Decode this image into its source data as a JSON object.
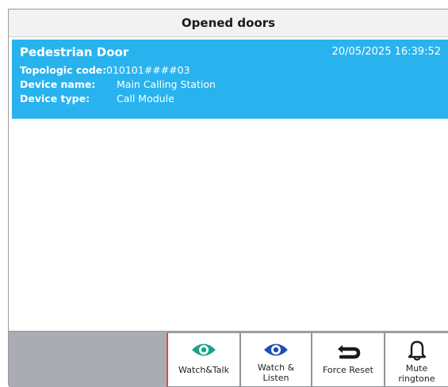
{
  "header": {
    "title": "Opened doors"
  },
  "door": {
    "name": "Pedestrian Door",
    "timestamp": "20/05/2025 16:39:52",
    "topologic_label": "Topologic code:",
    "topologic_value": "010101####03",
    "device_name_label": "Device name:",
    "device_name_value": "Main Calling Station",
    "device_type_label": "Device type:",
    "device_type_value": "Call Module"
  },
  "buttons": {
    "watch_talk": {
      "label": "Watch&Talk",
      "icon": "eye-icon",
      "color": "#17a589"
    },
    "watch_listen": {
      "label": "Watch &\nListen",
      "icon": "eye-icon",
      "color": "#1f4fb3"
    },
    "force_reset": {
      "label": "Force Reset",
      "icon": "refresh-icon",
      "color": "#1a1a1a"
    },
    "mute_ringtone": {
      "label": "Mute\nringtone",
      "icon": "bell-icon",
      "color": "#1a1a1a"
    }
  },
  "colors": {
    "card": "#29b3ee",
    "bar": "#a9adb2",
    "accent_border": "#e0454f"
  }
}
